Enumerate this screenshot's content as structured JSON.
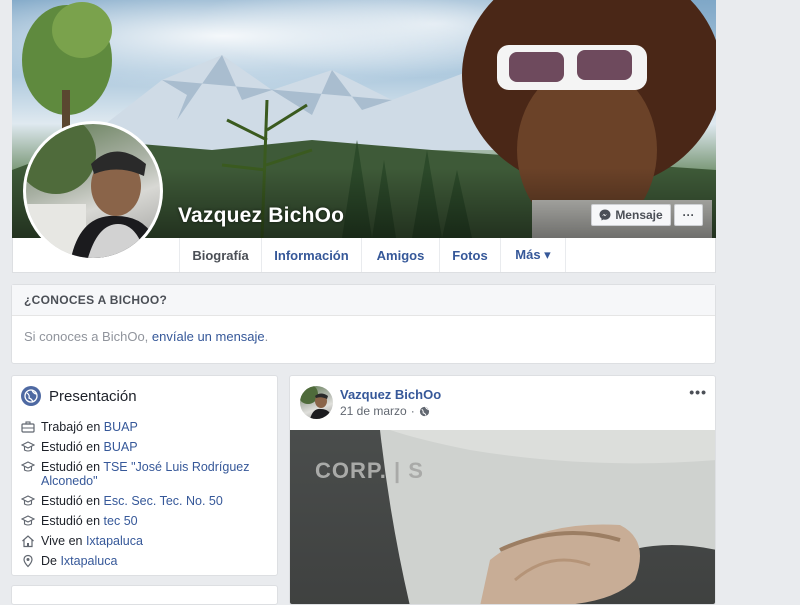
{
  "profile": {
    "name": "Vazquez BichOo",
    "message_button": "Mensaje",
    "more_button": "···"
  },
  "tabs": [
    {
      "label": "Biografía"
    },
    {
      "label": "Información"
    },
    {
      "label": "Amigos"
    },
    {
      "label": "Fotos"
    },
    {
      "label": "Más ▾"
    }
  ],
  "know": {
    "heading": "¿CONOCES A BICHOO?",
    "text_prefix": "Si conoces a BichOo, ",
    "link": "envíale un mensaje",
    "text_suffix": "."
  },
  "intro": {
    "title": "Presentación",
    "items": [
      {
        "icon": "briefcase-icon",
        "prefix": "Trabajó en ",
        "link": "BUAP"
      },
      {
        "icon": "graduation-cap-icon",
        "prefix": "Estudió en ",
        "link": "BUAP"
      },
      {
        "icon": "graduation-cap-icon",
        "prefix": "Estudió en ",
        "link": "TSE \"José Luis Rodríguez Alconedo\""
      },
      {
        "icon": "graduation-cap-icon",
        "prefix": "Estudió en ",
        "link": "Esc. Sec. Tec. No. 50"
      },
      {
        "icon": "graduation-cap-icon",
        "prefix": "Estudió en ",
        "link": "tec 50"
      },
      {
        "icon": "home-icon",
        "prefix": "Vive en ",
        "link": "Ixtapaluca"
      },
      {
        "icon": "location-pin-icon",
        "prefix": "De ",
        "link": "Ixtapaluca"
      }
    ]
  },
  "post": {
    "author": "Vazquez BichOo",
    "date": "21 de marzo",
    "menu": "•••",
    "image_text": "CORP. | S"
  },
  "colors": {
    "link": "#365899",
    "background": "#e9ebee",
    "accent": "#4e69a2"
  }
}
